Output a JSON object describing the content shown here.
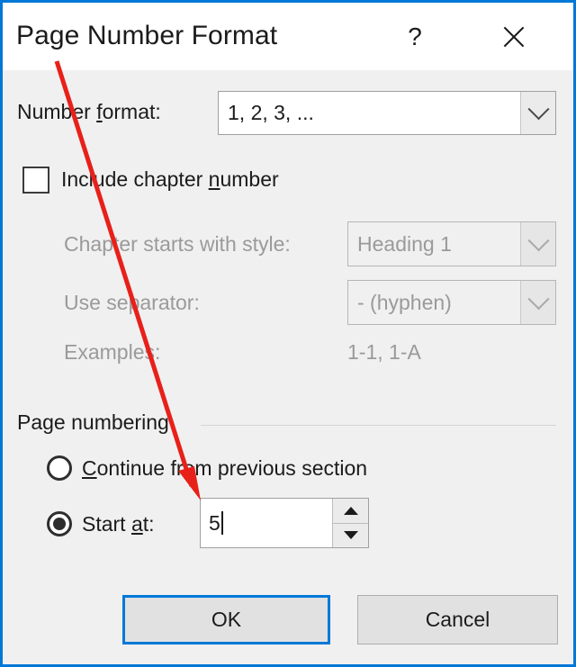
{
  "dialog": {
    "title": "Page Number Format",
    "help_label": "?",
    "close_label": "close-icon",
    "accent_color": "#0078d7",
    "background_color": "#f0f0f0",
    "titlebar_color": "#ffffff"
  },
  "number_format": {
    "label_pre": "Number ",
    "label_accel": "f",
    "label_post": "ormat:",
    "value": "1, 2, 3, ...",
    "options": [
      "1, 2, 3, ..."
    ]
  },
  "include_chapter": {
    "label_pre": "Include chapter ",
    "label_accel": "n",
    "label_post": "umber",
    "checked": false
  },
  "chapter_style": {
    "label": "Chapter starts with style:",
    "value": "Heading 1",
    "enabled": false
  },
  "separator": {
    "label": "Use separator:",
    "value": "-    (hyphen)",
    "enabled": false
  },
  "examples": {
    "label": "Examples:",
    "value": "1-1, 1-A"
  },
  "page_numbering": {
    "group_label": "Page numbering",
    "continue_option": {
      "label_pre": "",
      "label_accel": "C",
      "label_post": "ontinue from previous section",
      "selected": false
    },
    "start_at_option": {
      "label_pre": "Start ",
      "label_accel": "a",
      "label_post": "t:",
      "selected": true,
      "value": "5"
    }
  },
  "buttons": {
    "ok": "OK",
    "cancel": "Cancel"
  },
  "annotation": {
    "color": "#e8201a",
    "type": "arrow",
    "points_to": "start-at-value"
  }
}
